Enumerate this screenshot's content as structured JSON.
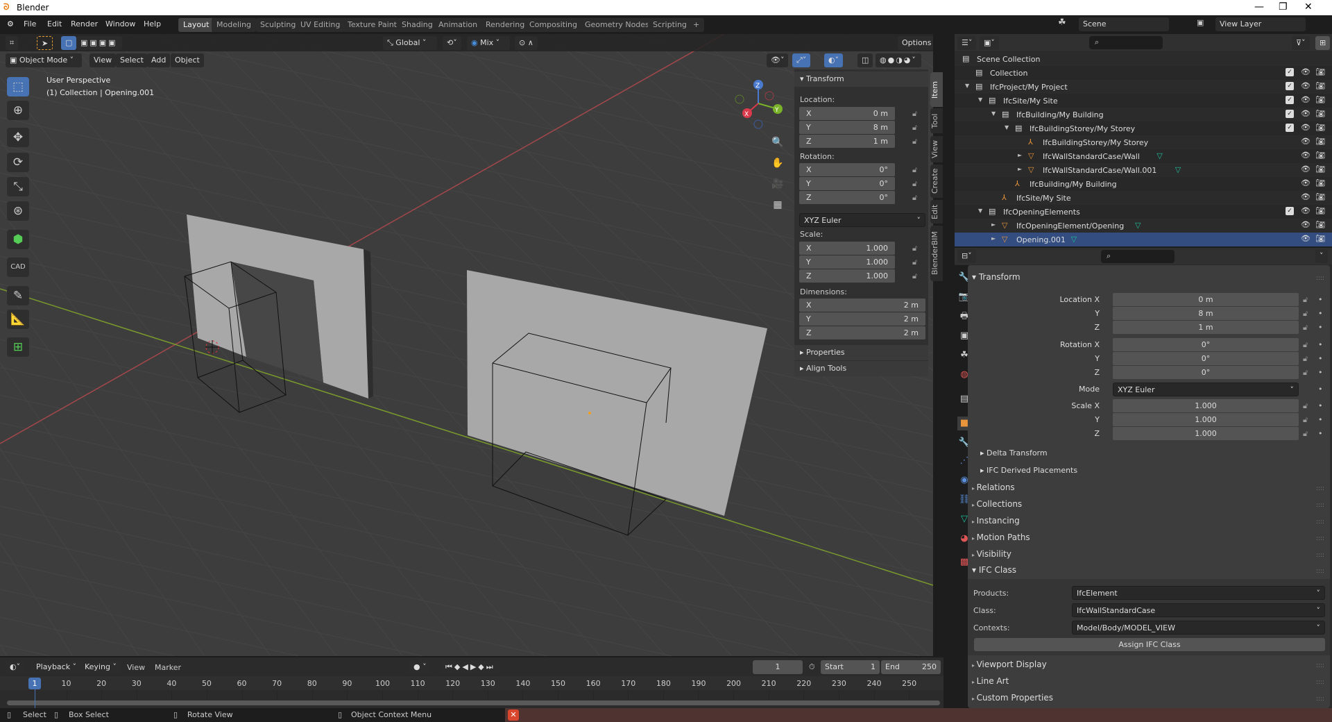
{
  "window": {
    "title": "Blender",
    "minimize": "—",
    "maximize": "❐",
    "close": "✕"
  },
  "menu": [
    "File",
    "Edit",
    "Render",
    "Window",
    "Help"
  ],
  "workspaces": [
    "Layout",
    "Modeling",
    "Sculpting",
    "UV Editing",
    "Texture Paint",
    "Shading",
    "Animation",
    "Rendering",
    "Compositing",
    "Geometry Nodes",
    "Scripting",
    "+"
  ],
  "scene": {
    "name": "Scene",
    "view_layer": "View Layer"
  },
  "viewport": {
    "orientation": "Global",
    "pivot": "Mix",
    "options": "Options",
    "mode": "Object Mode",
    "menus": [
      "View",
      "Select",
      "Add",
      "Object"
    ],
    "overlay_line1": "User Perspective",
    "overlay_line2": "(1) Collection | Opening.001",
    "gizmo": {
      "x": "X",
      "y": "Y",
      "z": "Z"
    }
  },
  "npanel": {
    "title": "Transform",
    "location_label": "Location:",
    "location": [
      [
        "X",
        "0 m"
      ],
      [
        "Y",
        "8 m"
      ],
      [
        "Z",
        "1 m"
      ]
    ],
    "rotation_label": "Rotation:",
    "rotation": [
      [
        "X",
        "0°"
      ],
      [
        "Y",
        "0°"
      ],
      [
        "Z",
        "0°"
      ]
    ],
    "rotation_mode": "XYZ Euler",
    "scale_label": "Scale:",
    "scale": [
      [
        "X",
        "1.000"
      ],
      [
        "Y",
        "1.000"
      ],
      [
        "Z",
        "1.000"
      ]
    ],
    "dimensions_label": "Dimensions:",
    "dimensions": [
      [
        "X",
        "2 m"
      ],
      [
        "Y",
        "2 m"
      ],
      [
        "Z",
        "2 m"
      ]
    ],
    "properties": "Properties",
    "align_tools": "Align Tools",
    "tabs": [
      "Item",
      "Tool",
      "View",
      "Create",
      "Edit",
      "BlenderBIM"
    ],
    "active_tab": "Item"
  },
  "outliner": {
    "rows": [
      {
        "label": "Scene Collection",
        "depth": 0,
        "icon": "collection",
        "exp": "",
        "check": false,
        "vis": false
      },
      {
        "label": "Collection",
        "depth": 1,
        "icon": "collection",
        "exp": "",
        "check": true,
        "vis": true
      },
      {
        "label": "IfcProject/My Project",
        "depth": 1,
        "icon": "collection",
        "exp": "▼",
        "check": true,
        "vis": true
      },
      {
        "label": "IfcSite/My Site",
        "depth": 2,
        "icon": "collection",
        "exp": "▼",
        "check": true,
        "vis": true
      },
      {
        "label": "IfcBuilding/My Building",
        "depth": 3,
        "icon": "collection",
        "exp": "▼",
        "check": true,
        "vis": true
      },
      {
        "label": "IfcBuildingStorey/My Storey",
        "depth": 4,
        "icon": "collection",
        "exp": "▼",
        "check": true,
        "vis": true
      },
      {
        "label": "IfcBuildingStorey/My Storey",
        "depth": 5,
        "icon": "empty",
        "exp": "",
        "check": false,
        "vis": true
      },
      {
        "label": "IfcWallStandardCase/Wall",
        "depth": 5,
        "icon": "mesh",
        "exp": "►",
        "check": false,
        "vis": true,
        "data": true
      },
      {
        "label": "IfcWallStandardCase/Wall.001",
        "depth": 5,
        "icon": "mesh",
        "exp": "►",
        "check": false,
        "vis": true,
        "data": true
      },
      {
        "label": "IfcBuilding/My Building",
        "depth": 4,
        "icon": "empty",
        "exp": "",
        "check": false,
        "vis": true
      },
      {
        "label": "IfcSite/My Site",
        "depth": 3,
        "icon": "empty",
        "exp": "",
        "check": false,
        "vis": true
      },
      {
        "label": "IfcOpeningElements",
        "depth": 2,
        "icon": "collection",
        "exp": "▼",
        "check": true,
        "vis": true
      },
      {
        "label": "IfcOpeningElement/Opening",
        "depth": 3,
        "icon": "mesh",
        "exp": "►",
        "check": false,
        "vis": true,
        "data": true
      },
      {
        "label": "Opening.001",
        "depth": 3,
        "icon": "mesh",
        "exp": "►",
        "check": false,
        "vis": true,
        "data": true,
        "selected": true
      }
    ]
  },
  "properties": {
    "transform": "Transform",
    "location": [
      [
        "Location X",
        "0 m"
      ],
      [
        "Y",
        "8 m"
      ],
      [
        "Z",
        "1 m"
      ]
    ],
    "rotation": [
      [
        "Rotation X",
        "0°"
      ],
      [
        "Y",
        "0°"
      ],
      [
        "Z",
        "0°"
      ]
    ],
    "mode_label": "Mode",
    "mode": "XYZ Euler",
    "scale": [
      [
        "Scale X",
        "1.000"
      ],
      [
        "Y",
        "1.000"
      ],
      [
        "Z",
        "1.000"
      ]
    ],
    "delta_transform": "Delta Transform",
    "ifc_derived": "IFC Derived Placements",
    "sections": [
      "Relations",
      "Collections",
      "Instancing",
      "Motion Paths",
      "Visibility"
    ],
    "ifc_class": "IFC Class",
    "products_label": "Products:",
    "products": "IfcElement",
    "class_label": "Class:",
    "class": "IfcWallStandardCase",
    "contexts_label": "Contexts:",
    "contexts": "Model/Body/MODEL_VIEW",
    "assign": "Assign IFC Class",
    "sections_after": [
      "Viewport Display",
      "Line Art",
      "Custom Properties"
    ]
  },
  "timeline": {
    "menus": [
      "Playback",
      "Keying",
      "View",
      "Marker"
    ],
    "current_frame": "1",
    "start_label": "Start",
    "start": "1",
    "end_label": "End",
    "end": "250",
    "ticks": [
      "1",
      "10",
      "20",
      "30",
      "40",
      "50",
      "60",
      "70",
      "80",
      "90",
      "100",
      "110",
      "120",
      "130",
      "140",
      "150",
      "160",
      "170",
      "180",
      "190",
      "200",
      "210",
      "220",
      "230",
      "240",
      "250"
    ]
  },
  "status": {
    "select": "Select",
    "box_select": "Box Select",
    "rotate": "Rotate View",
    "context_menu": "Object Context Menu"
  },
  "colors": {
    "accent": "#4772b3",
    "object_orange": "#e8943a",
    "mesh_data_green": "#1dc09a",
    "error_bar": "#4f3330"
  }
}
